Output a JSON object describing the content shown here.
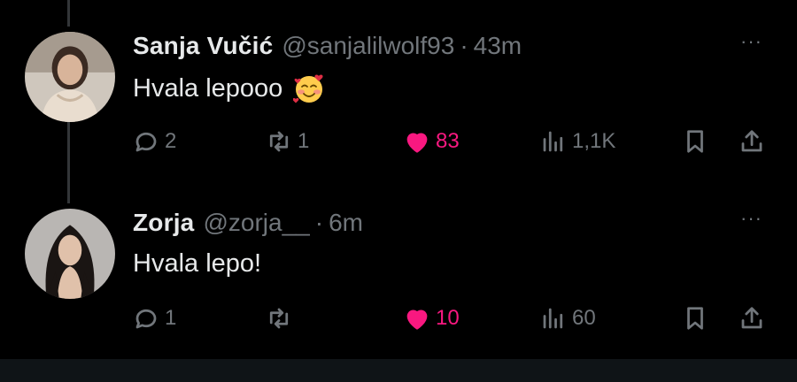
{
  "tweets": [
    {
      "name": "Sanja Vučić",
      "handle": "@sanjalilwolf93",
      "separator": "·",
      "time": "43m",
      "text": "Hvala lepooo",
      "emoji": "smiling-face-with-hearts-icon",
      "more": "···",
      "replies": "2",
      "retweets": "1",
      "likes": "83",
      "views": "1,1K"
    },
    {
      "name": "Zorja",
      "handle": "@zorja__",
      "separator": "·",
      "time": "6m",
      "text": "Hvala lepo!",
      "more": "···",
      "replies": "1",
      "retweets": "",
      "likes": "10",
      "views": "60"
    }
  ],
  "colors": {
    "background": "#000000",
    "text": "#e7e9ea",
    "muted": "#71767b",
    "like": "#f91880"
  }
}
